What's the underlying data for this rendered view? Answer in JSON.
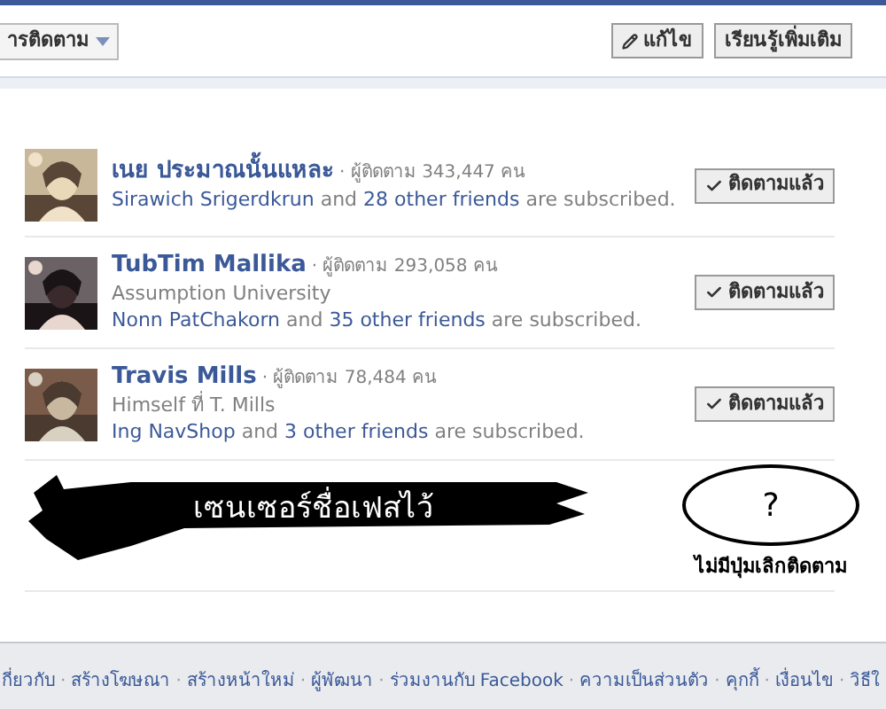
{
  "header": {
    "dropdown": "ารติดตาม",
    "buttons": [
      {
        "kind": "edit",
        "label": "แก้ไข"
      },
      {
        "kind": "plain",
        "label": "เรียนรู้เพิ่มเติม"
      }
    ]
  },
  "rows": [
    {
      "name": "เนย ประมาณนั้นแหละ",
      "count": "· ผู้ติดตาม 343,447 คน",
      "friend": "Sirawich Srigerdkrun",
      "joiner": "and",
      "others": "28 other friends",
      "tail": "are subscribed.",
      "button": "ติดตามแล้ว",
      "subscribed": true
    },
    {
      "name": "TubTim Mallika",
      "count": "· ผู้ติดตาม 293,058 คน",
      "detail": "Assumption University",
      "friend": "Nonn PatChakorn",
      "joiner": "and",
      "others": "35 other friends",
      "tail": "are subscribed.",
      "button": "ติดตามแล้ว",
      "subscribed": true
    },
    {
      "name": "Travis Mills",
      "count": "· ผู้ติดตาม 78,484 คน",
      "detail": "Himself ที่ T. Mills",
      "friend": "Ing NavShop",
      "joiner": "and",
      "others": "3 other friends",
      "tail": "are subscribed.",
      "button": "ติดตามแล้ว",
      "subscribed": true
    }
  ],
  "annotation": {
    "censor": "เซนเซอร์ชื่อเฟสไว้",
    "mark": "?",
    "caption": "ไม่มีปุ่มเลิกติดตาม"
  },
  "footer": {
    "separator": "·",
    "links": [
      "กี่ยวกับ",
      "สร้างโฆษณา",
      "สร้างหน้าใหม่",
      "ผู้พัฒนา",
      "ร่วมงานกับ Facebook",
      "ความเป็นส่วนตัว",
      "คุกกี้",
      "เงื่อนไข",
      "วิธีใ"
    ]
  }
}
